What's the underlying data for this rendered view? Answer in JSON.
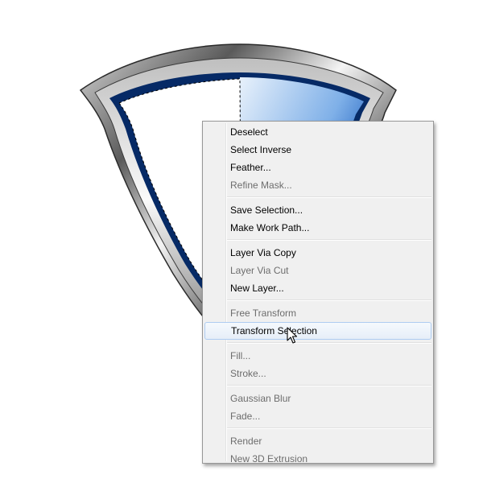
{
  "context_menu": {
    "groups": [
      {
        "items": [
          {
            "label": "Deselect",
            "enabled": true
          },
          {
            "label": "Select Inverse",
            "enabled": true
          },
          {
            "label": "Feather...",
            "enabled": true
          },
          {
            "label": "Refine Mask...",
            "enabled": false
          }
        ]
      },
      {
        "items": [
          {
            "label": "Save Selection...",
            "enabled": true
          },
          {
            "label": "Make Work Path...",
            "enabled": true
          }
        ]
      },
      {
        "items": [
          {
            "label": "Layer Via Copy",
            "enabled": true
          },
          {
            "label": "Layer Via Cut",
            "enabled": false
          },
          {
            "label": "New Layer...",
            "enabled": true
          }
        ]
      },
      {
        "items": [
          {
            "label": "Free Transform",
            "enabled": false
          },
          {
            "label": "Transform Selection",
            "enabled": true,
            "highlighted": true
          }
        ]
      },
      {
        "items": [
          {
            "label": "Fill...",
            "enabled": false
          },
          {
            "label": "Stroke...",
            "enabled": false
          }
        ]
      },
      {
        "items": [
          {
            "label": "Gaussian Blur",
            "enabled": false
          },
          {
            "label": "Fade...",
            "enabled": false
          }
        ]
      },
      {
        "items": [
          {
            "label": "Render",
            "enabled": false
          },
          {
            "label": "New 3D Extrusion",
            "enabled": false
          }
        ]
      }
    ]
  },
  "colors": {
    "menu_bg": "#f0f0f0",
    "menu_border": "#979797",
    "highlight_border": "#aeccf1",
    "disabled_text": "#6d6d6d",
    "shield_blue": "#0a4a9a"
  },
  "icons": {
    "cursor": "arrow-cursor-icon",
    "artwork": "shield-artwork"
  }
}
